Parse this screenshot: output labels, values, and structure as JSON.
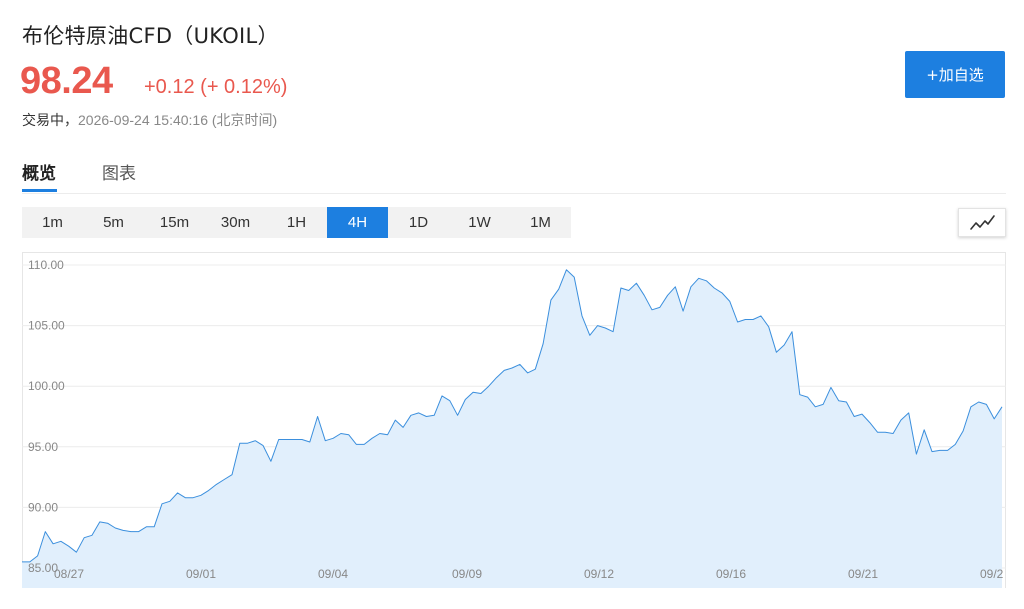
{
  "header": {
    "title": "布伦特原油CFD（UKOIL）",
    "price": "98.24",
    "change": "+0.12 (+ 0.12%)",
    "status": "交易中，",
    "timestamp": "2026-09-24 15:40:16 (北京时间)",
    "price_color": "#e9584e"
  },
  "watch_button": {
    "label": "+加自选",
    "color": "#1d7fe0"
  },
  "tabs": [
    {
      "label": "概览",
      "active": true
    },
    {
      "label": "图表",
      "active": false
    }
  ],
  "ranges": [
    {
      "label": "1m"
    },
    {
      "label": "5m"
    },
    {
      "label": "15m"
    },
    {
      "label": "30m"
    },
    {
      "label": "1H"
    },
    {
      "label": "4H",
      "active": true
    },
    {
      "label": "1D"
    },
    {
      "label": "1W"
    },
    {
      "label": "1M"
    }
  ],
  "chart_type_icon": "line-chart-icon",
  "chart_data": {
    "type": "area",
    "ylim": [
      85,
      110
    ],
    "y_ticks": [
      "110.00",
      "105.00",
      "100.00",
      "95.00",
      "90.00",
      "85.00"
    ],
    "x_ticks": [
      "08/27",
      "09/01",
      "09/04",
      "09/09",
      "09/12",
      "09/16",
      "09/21",
      "09/2"
    ],
    "line_color": "#3b8fdd",
    "fill_color": "#e1effc",
    "series": [
      {
        "values": [
          85.5,
          85.5,
          86.0,
          88.0,
          87.0,
          87.2,
          86.8,
          86.3,
          87.5,
          87.7,
          88.8,
          88.7,
          88.3,
          88.1,
          88.0,
          88.0,
          88.4,
          88.4,
          90.3,
          90.5,
          91.2,
          90.8,
          90.8,
          91.0,
          91.4,
          91.9,
          92.3,
          92.7,
          95.3,
          95.3,
          95.5,
          95.1,
          93.8,
          95.6,
          95.6,
          95.6,
          95.6,
          95.4,
          97.5,
          95.5,
          95.7,
          96.1,
          96.0,
          95.2,
          95.2,
          95.7,
          96.1,
          96.0,
          97.2,
          96.6,
          97.6,
          97.8,
          97.5,
          97.6,
          99.2,
          98.8,
          97.6,
          98.9,
          99.5,
          99.4,
          100.0,
          100.7,
          101.3,
          101.5,
          101.8,
          101.1,
          101.4,
          103.5,
          107.1,
          108.0,
          109.6,
          109.0,
          105.8,
          104.2,
          105.0,
          104.8,
          104.5,
          108.1,
          107.9,
          108.5,
          107.5,
          106.3,
          106.5,
          107.5,
          108.2,
          106.2,
          108.2,
          108.9,
          108.7,
          108.1,
          107.7,
          107.0,
          105.3,
          105.5,
          105.5,
          105.8,
          104.9,
          102.8,
          103.4,
          104.5,
          99.3,
          99.1,
          98.3,
          98.5,
          99.9,
          98.8,
          98.7,
          97.5,
          97.7,
          97.0,
          96.2,
          96.2,
          96.1,
          97.2,
          97.8,
          94.4,
          96.4,
          94.6,
          94.7,
          94.7,
          95.2,
          96.3,
          98.3,
          98.7,
          98.5,
          97.3,
          98.3
        ]
      }
    ]
  }
}
